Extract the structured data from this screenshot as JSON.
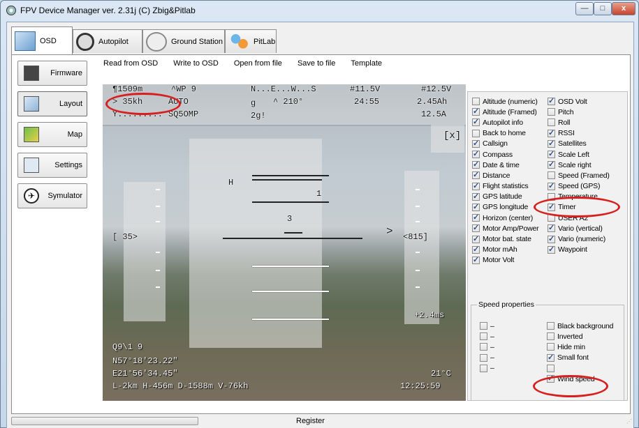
{
  "window": {
    "title": "FPV Device Manager ver. 2.31j  (C) Zbig&Pitlab",
    "min_glyph": "—",
    "max_glyph": "□",
    "close_glyph": "x"
  },
  "top_tabs": [
    {
      "label": "OSD",
      "icon": "osd-icon"
    },
    {
      "label": "Autopilot",
      "icon": "autopilot-icon"
    },
    {
      "label": "Ground Station",
      "icon": "ground-station-icon"
    },
    {
      "label": "PitLab",
      "icon": "pitlab-icon"
    }
  ],
  "side_tabs": [
    {
      "label": "Firmware",
      "icon": "firmware-icon"
    },
    {
      "label": "Layout",
      "icon": "layout-icon"
    },
    {
      "label": "Map",
      "icon": "map-icon"
    },
    {
      "label": "Settings",
      "icon": "settings-icon"
    },
    {
      "label": "Symulator",
      "icon": "simulator-icon",
      "glyph": "✈"
    }
  ],
  "menu": [
    "Read from OSD",
    "Write to OSD",
    "Open from file",
    "Save to file",
    "Template"
  ],
  "osd": {
    "altitude": "¶1509m",
    "wp": "^WP 9",
    "compass": "N...E...W...S",
    "main_volt": "#11.5V",
    "osd_volt": "#12.5V",
    "speed": "> 35kh",
    "mode": "AUTO",
    "heading": "^ 210°",
    "gps_glyph": "g",
    "time": "24:55",
    "mah": "2.45Ah",
    "rssi": "Y.........",
    "callsign": "SQ5OMP",
    "sat": "2g!",
    "amps": "12.5A",
    "close": "[x]",
    "home": "H",
    "pitch1": "1",
    "pitch3": "3",
    "left_scale": "[ 35>",
    "right_scale": "<815]",
    "arrow": ">",
    "vario": "+2.4ms",
    "sats_count": "Q9\\1 9",
    "lat": "N57°18'23.22\"",
    "lon": "E21°56'34.45\"",
    "temp": "21°C",
    "stats": "L-2km H-456m D-1588m V-76kh",
    "clock": "12:25:59"
  },
  "checkboxes_left": [
    {
      "label": "Altitude (numeric)",
      "checked": false
    },
    {
      "label": "Altitude (Framed)",
      "checked": true
    },
    {
      "label": "Autopilot info",
      "checked": true
    },
    {
      "label": "Back to home",
      "checked": false
    },
    {
      "label": "Callsign",
      "checked": true
    },
    {
      "label": "Compass",
      "checked": true
    },
    {
      "label": "Date & time",
      "checked": true
    },
    {
      "label": "Distance",
      "checked": true
    },
    {
      "label": "Flight statistics",
      "checked": true
    },
    {
      "label": "GPS latitude",
      "checked": true
    },
    {
      "label": "GPS longitude",
      "checked": true
    },
    {
      "label": "Horizon (center)",
      "checked": true
    },
    {
      "label": "Motor Amp/Power",
      "checked": true
    },
    {
      "label": "Motor bat. state",
      "checked": true
    },
    {
      "label": "Motor mAh",
      "checked": true
    },
    {
      "label": "Motor Volt",
      "checked": true
    }
  ],
  "checkboxes_right": [
    {
      "label": "OSD Volt",
      "checked": true
    },
    {
      "label": "Pitch",
      "checked": false
    },
    {
      "label": "Roll",
      "checked": false
    },
    {
      "label": "RSSI",
      "checked": true
    },
    {
      "label": "Satellites",
      "checked": true
    },
    {
      "label": "Scale Left",
      "checked": true
    },
    {
      "label": "Scale right",
      "checked": true
    },
    {
      "label": "Speed (Framed)",
      "checked": false
    },
    {
      "label": "Speed (GPS)",
      "checked": true
    },
    {
      "label": "Temperature",
      "checked": false
    },
    {
      "label": "Timer",
      "checked": true
    },
    {
      "label": "USER A2",
      "checked": false
    },
    {
      "label": "Vario (vertical)",
      "checked": true
    },
    {
      "label": "Vario (numeric)",
      "checked": true
    },
    {
      "label": "Waypoint",
      "checked": true
    }
  ],
  "speed_properties": {
    "title": "Speed  properties",
    "dash_items": [
      "–",
      "–",
      "–",
      "–",
      "–"
    ],
    "options": [
      {
        "label": "Black background",
        "checked": false
      },
      {
        "label": "Inverted",
        "checked": false
      },
      {
        "label": "Hide min",
        "checked": false
      },
      {
        "label": "Small font",
        "checked": true
      },
      {
        "label": "",
        "checked": false
      },
      {
        "label": "Wind speed",
        "checked": true
      }
    ]
  },
  "status": {
    "register": "Register",
    "grip": "⋰"
  },
  "colors": {
    "highlight": "#d62020",
    "checkmark": "#2b4f88"
  }
}
